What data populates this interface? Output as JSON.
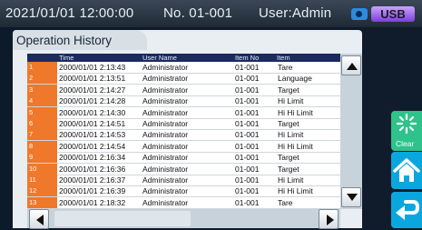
{
  "status_bar": {
    "datetime": "2021/01/01 12:00:00",
    "device_no": "No. 01-001",
    "user": "User:Admin",
    "usb_label": "USB"
  },
  "panel": {
    "title": "Operation History"
  },
  "table": {
    "headers": [
      "Time",
      "User Name",
      "Item No",
      "Item"
    ],
    "rows": [
      {
        "n": "1",
        "time": "2000/01/01  2:13:43",
        "user": "Administrator",
        "item_no": "01-001",
        "item": "Tare"
      },
      {
        "n": "2",
        "time": "2000/01/01  2:13:51",
        "user": "Administrator",
        "item_no": "01-001",
        "item": "Language"
      },
      {
        "n": "3",
        "time": "2000/01/01  2:14:27",
        "user": "Administrator",
        "item_no": "01-001",
        "item": "Target"
      },
      {
        "n": "4",
        "time": "2000/01/01  2:14:28",
        "user": "Administrator",
        "item_no": "01-001",
        "item": "Hi Limit"
      },
      {
        "n": "5",
        "time": "2000/01/01  2:14:30",
        "user": "Administrator",
        "item_no": "01-001",
        "item": "Hi Hi Limit"
      },
      {
        "n": "6",
        "time": "2000/01/01  2:14:51",
        "user": "Administrator",
        "item_no": "01-001",
        "item": "Target"
      },
      {
        "n": "7",
        "time": "2000/01/01  2:14:53",
        "user": "Administrator",
        "item_no": "01-001",
        "item": "Hi Limit"
      },
      {
        "n": "8",
        "time": "2000/01/01  2:14:54",
        "user": "Administrator",
        "item_no": "01-001",
        "item": "Hi Hi Limit"
      },
      {
        "n": "9",
        "time": "2000/01/01  2:16:34",
        "user": "Administrator",
        "item_no": "01-001",
        "item": "Target"
      },
      {
        "n": "10",
        "time": "2000/01/01  2:16:36",
        "user": "Administrator",
        "item_no": "01-001",
        "item": "Target"
      },
      {
        "n": "11",
        "time": "2000/01/01  2:16:37",
        "user": "Administrator",
        "item_no": "01-001",
        "item": "Hi Limit"
      },
      {
        "n": "12",
        "time": "2000/01/01  2:16:39",
        "user": "Administrator",
        "item_no": "01-001",
        "item": "Hi Hi Limit"
      },
      {
        "n": "13",
        "time": "2000/01/01  2:18:32",
        "user": "Administrator",
        "item_no": "01-001",
        "item": "Tare"
      }
    ]
  },
  "side": {
    "clear_label": "Clear"
  },
  "icons": {
    "camera": "camera-icon",
    "clear": "clear-sparkle-icon",
    "home": "home-icon",
    "back": "return-arrow-icon",
    "scroll_up": "triangle-up-icon",
    "scroll_down": "triangle-down-icon",
    "scroll_left": "triangle-left-icon",
    "scroll_right": "triangle-right-icon"
  },
  "colors": {
    "row_number_bg": "#f0782a",
    "header_bg": "#1c2a60",
    "clear_button": "#2ec38b",
    "nav_button": "#0aa7df",
    "usb_badge": "#9a63f0"
  }
}
